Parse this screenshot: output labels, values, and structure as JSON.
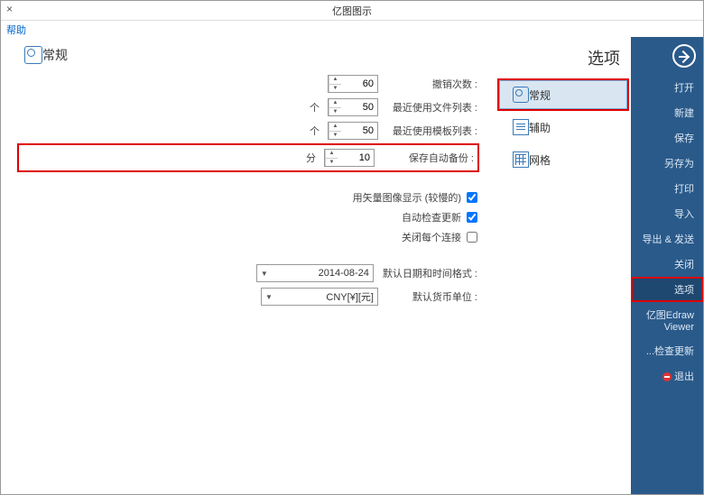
{
  "window": {
    "title": "亿图图示",
    "close": "×",
    "menu": "帮助"
  },
  "sidebar": {
    "items": [
      {
        "label": "打开"
      },
      {
        "label": "新建"
      },
      {
        "label": "保存"
      },
      {
        "label": "另存为"
      },
      {
        "label": "打印"
      },
      {
        "label": "导入"
      },
      {
        "label": "导出 & 发送"
      },
      {
        "label": "关闭"
      },
      {
        "label": "选项"
      },
      {
        "label": "亿图Edraw Viewer"
      },
      {
        "label": "检查更新..."
      },
      {
        "label": "退出"
      }
    ]
  },
  "categories": [
    {
      "label": "常规"
    },
    {
      "label": "辅助"
    },
    {
      "label": "网格"
    }
  ],
  "page": {
    "heading": "选项",
    "section_title": "常规",
    "fields": {
      "undo": {
        "label": "撤销次数 :",
        "value": "60",
        "unit": ""
      },
      "recent": {
        "label": "最近使用文件列表 :",
        "value": "50",
        "unit": "个"
      },
      "tpl": {
        "label": "最近使用模板列表 :",
        "value": "50",
        "unit": "个"
      },
      "backup": {
        "label": "保存自动备份 :",
        "value": "10",
        "unit": "分"
      }
    },
    "checks": {
      "vector": {
        "label": "用矢量图像显示 (较慢的)",
        "checked": true
      },
      "auto_up": {
        "label": "自动检查更新",
        "checked": true
      },
      "no_wiz": {
        "label": "关闭每个连接",
        "checked": false
      }
    },
    "combos": {
      "date": {
        "label": "默认日期和时间格式 :",
        "value": "2014-08-24"
      },
      "currency": {
        "label": "默认货币单位 :",
        "value": "CNY[¥][元]"
      }
    }
  }
}
